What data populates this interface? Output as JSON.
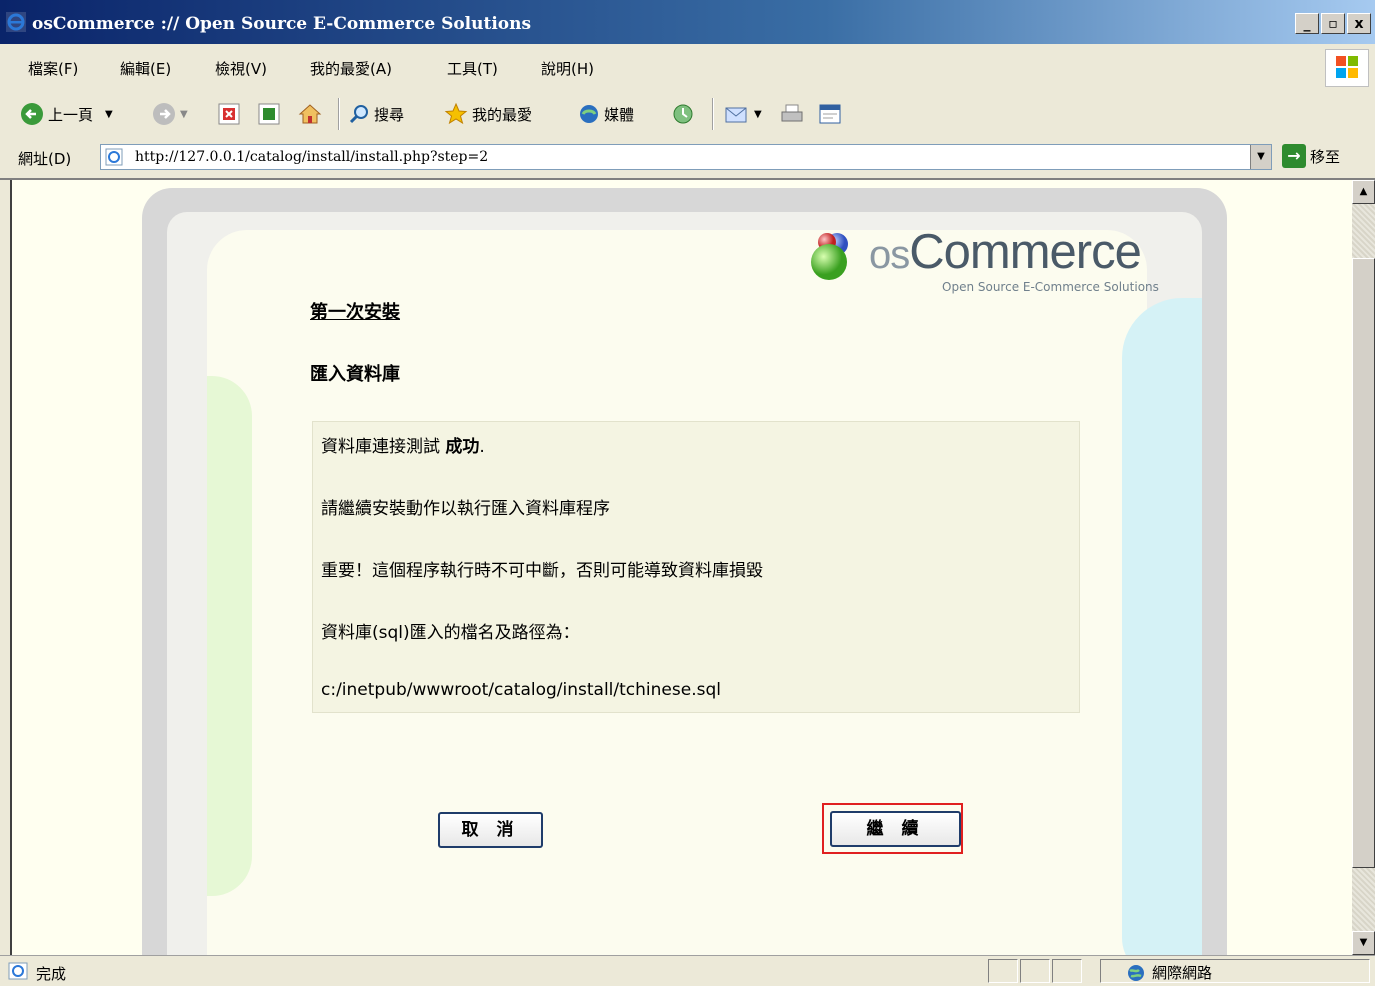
{
  "window": {
    "title": "osCommerce :// Open Source E-Commerce Solutions",
    "min": "_",
    "max": "▫",
    "close": "x"
  },
  "menu": [
    "檔案(F)",
    "編輯(E)",
    "檢視(V)",
    "我的最愛(A)",
    "工具(T)",
    "說明(H)"
  ],
  "toolbar": {
    "back": "上一頁",
    "search": "搜尋",
    "favorites": "我的最愛",
    "media": "媒體"
  },
  "address": {
    "label": "網址(D)",
    "url": "http://127.0.0.1/catalog/install/install.php?step=2",
    "go": "移至"
  },
  "logo": {
    "prefix": "os",
    "name": "Commerce",
    "tagline": "Open Source E-Commerce Solutions"
  },
  "page": {
    "heading": "第一次安裝",
    "subheading": "匯入資料庫",
    "line1_prefix": "資料庫連接測試 ",
    "line1_bold": "成功",
    "line1_suffix": ".",
    "line2": "請繼續安裝動作以執行匯入資料庫程序",
    "line3": "重要！這個程序執行時不可中斷，否則可能導致資料庫損毀",
    "line4": "資料庫(sql)匯入的檔名及路徑為：",
    "line5": "c:/inetpub/wwwroot/catalog/install/tchinese.sql"
  },
  "buttons": {
    "cancel": "取 消",
    "continue": "繼 續"
  },
  "status": {
    "text": "完成",
    "zone": "網際網路"
  },
  "colors": {
    "titlebar": "#0a246a",
    "panel": "#fcfcef",
    "green_curve": "#e6f8d5",
    "blue_curve": "#d5f2f6",
    "focus": "#e02020"
  }
}
